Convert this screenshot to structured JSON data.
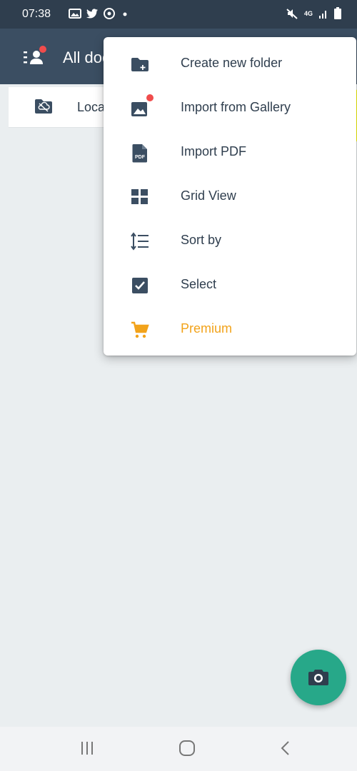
{
  "status_bar": {
    "time": "07:38",
    "left_icons": [
      "image-icon",
      "twitter-icon",
      "app-icon",
      "dot-icon"
    ],
    "right_icons": [
      "mute-icon",
      "lte-icon",
      "signal-icon",
      "battery-icon"
    ],
    "network": "4G"
  },
  "app_bar": {
    "title": "All documents",
    "menu_icon": "menu-icon",
    "notification_color": "#f04c4c"
  },
  "folder_row": {
    "label": "Local",
    "icon": "cloud-off-folder-icon"
  },
  "menu": {
    "items": [
      {
        "label": "Create new folder",
        "icon": "create-folder-icon"
      },
      {
        "label": "Import from Gallery",
        "icon": "gallery-icon"
      },
      {
        "label": "Import PDF",
        "icon": "pdf-icon",
        "icon_text": "PDF"
      },
      {
        "label": "Grid View",
        "icon": "grid-icon"
      },
      {
        "label": "Sort by",
        "icon": "sort-icon"
      },
      {
        "label": "Select",
        "icon": "checkbox-icon"
      },
      {
        "label": "Premium",
        "icon": "cart-icon"
      }
    ]
  },
  "fab": {
    "icon": "camera-icon",
    "color": "#27a889"
  },
  "nav_bar": {
    "buttons": [
      "recent-apps-icon",
      "home-icon",
      "back-icon"
    ]
  },
  "colors": {
    "status_bar": "#2f3e4e",
    "app_bar": "#3b4e62",
    "accent_premium": "#f2a31b",
    "annotation_arrow": "#ffff00"
  }
}
